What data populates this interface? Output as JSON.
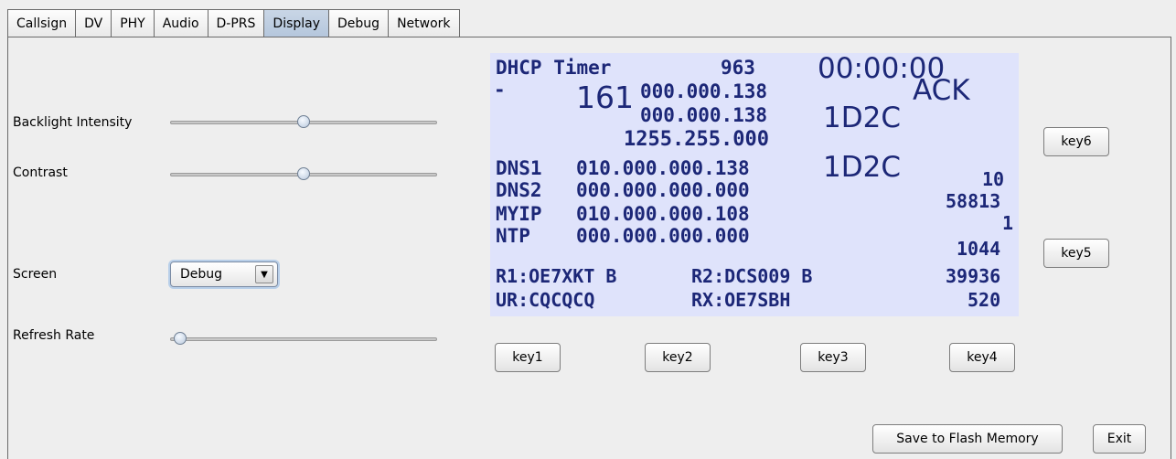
{
  "tabs": [
    {
      "label": "Callsign"
    },
    {
      "label": "DV"
    },
    {
      "label": "PHY"
    },
    {
      "label": "Audio"
    },
    {
      "label": "D-PRS"
    },
    {
      "label": "Display"
    },
    {
      "label": "Debug"
    },
    {
      "label": "Network"
    }
  ],
  "active_tab": "Display",
  "controls": {
    "backlight": {
      "label": "Backlight Intensity",
      "value_fraction": 0.5
    },
    "contrast": {
      "label": "Contrast",
      "value_fraction": 0.5
    },
    "screen": {
      "label": "Screen",
      "selected": "Debug"
    },
    "refresh": {
      "label": "Refresh Rate",
      "value_fraction": 0.0
    }
  },
  "lcd": {
    "r1_a": "DHCP Timer",
    "r1_b": "963",
    "r1_c": "00:00:00",
    "r2_a": "-",
    "r2_b": "161",
    "r2_c": "000.000.138",
    "r2_d": "ACK",
    "r3_a": "000.000.138",
    "r3_b": "1D2C",
    "r4_a": "1255.255.000",
    "r5_a": "DNS1",
    "r5_b": "010.000.000.138",
    "r5_c": "1D2C",
    "r5_d": "10",
    "r6_a": "DNS2",
    "r6_b": "000.000.000.000",
    "r6_c": "58813",
    "r7_a": "MYIP",
    "r7_b": "010.000.000.108",
    "r7_c": "1",
    "r8_a": "NTP",
    "r8_b": "000.000.000.000",
    "r8_c": "1044",
    "r9_a": "R1:OE7XKT B",
    "r9_b": "R2:DCS009 B",
    "r9_c": "39936",
    "r10_a": "UR:CQCQCQ",
    "r10_b": "RX:OE7SBH",
    "r10_c": "520"
  },
  "keys": {
    "key1": "key1",
    "key2": "key2",
    "key3": "key3",
    "key4": "key4",
    "key5": "key5",
    "key6": "key6"
  },
  "actions": {
    "save": "Save to Flash Memory",
    "exit": "Exit"
  },
  "colors": {
    "lcd_background": "#dfe3fb",
    "lcd_text": "#1c2777",
    "active_tab": "#b4c6dc"
  }
}
